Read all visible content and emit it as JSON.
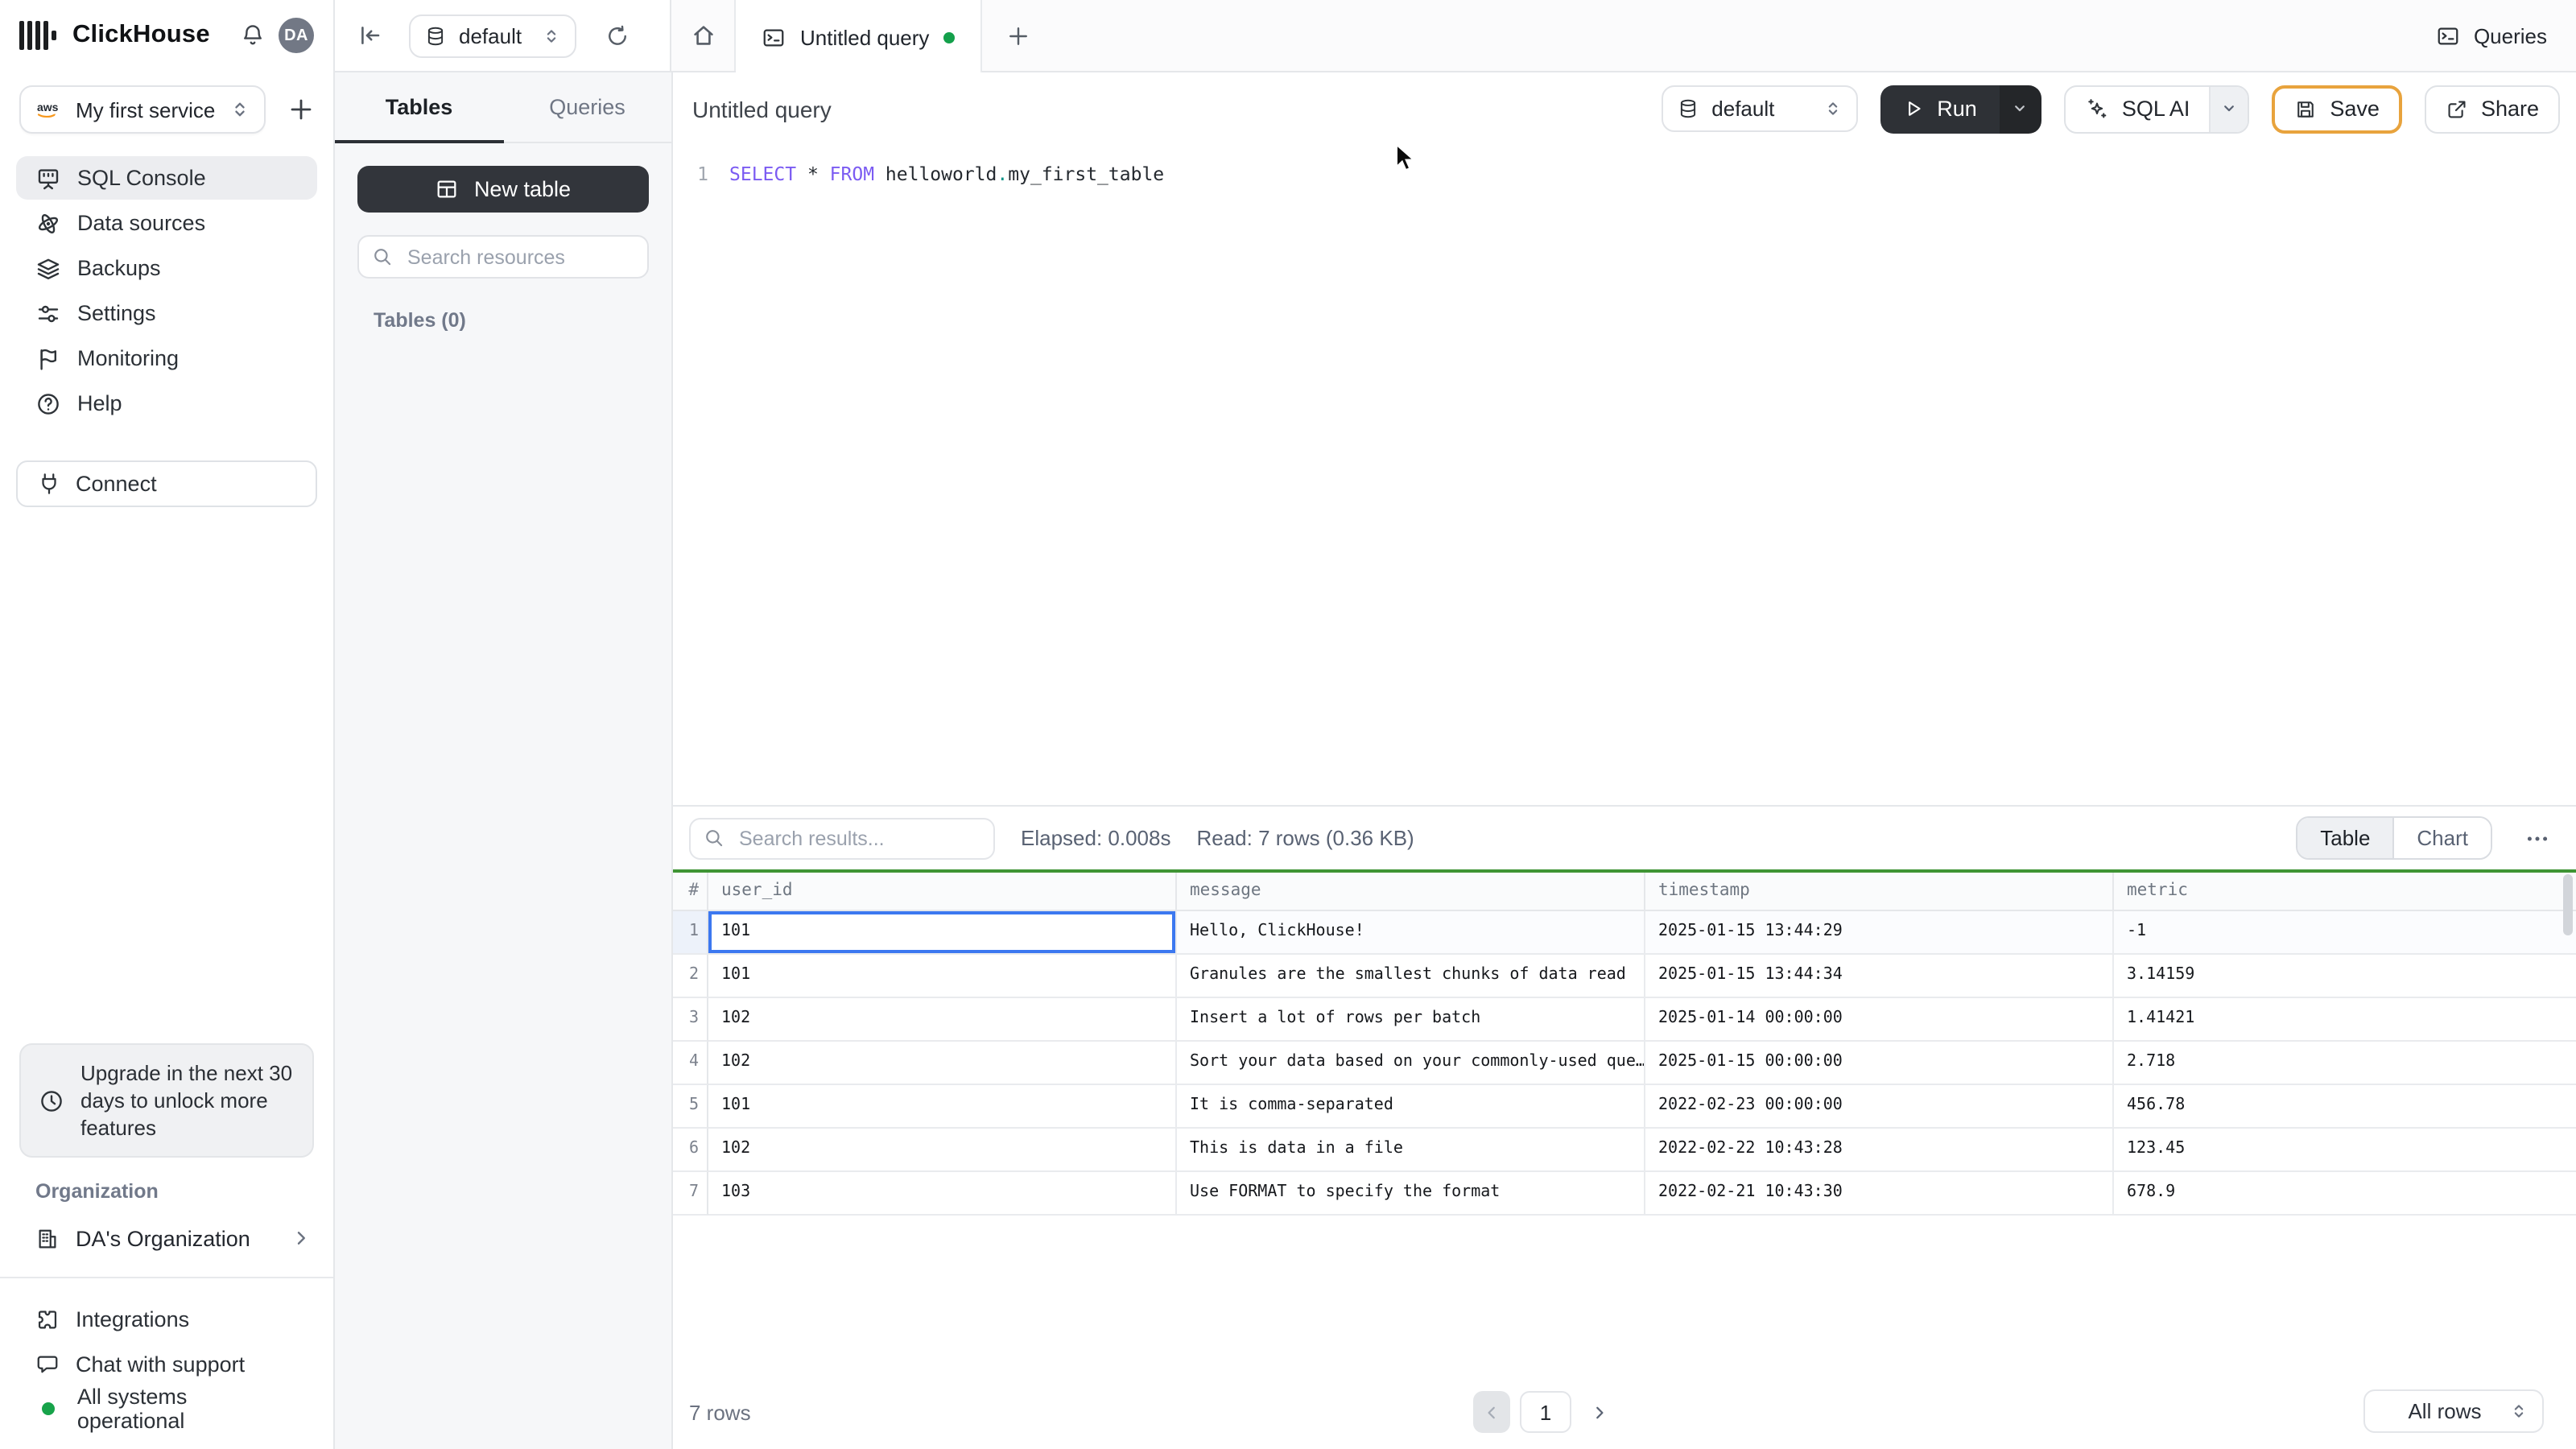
{
  "app": {
    "brand": "ClickHouse",
    "avatar": "DA"
  },
  "sidebar": {
    "service": {
      "label": "My first service",
      "provider": "aws"
    },
    "nav": [
      {
        "label": "SQL Console"
      },
      {
        "label": "Data sources"
      },
      {
        "label": "Backups"
      },
      {
        "label": "Settings"
      },
      {
        "label": "Monitoring"
      },
      {
        "label": "Help"
      }
    ],
    "connect": "Connect",
    "upgrade_notice": "Upgrade in the next 30 days to unlock more features",
    "org_section": "Organization",
    "org_name": "DA's Organization",
    "footer": [
      {
        "label": "Integrations"
      },
      {
        "label": "Chat with support"
      },
      {
        "label": "All systems operational"
      }
    ]
  },
  "topbar": {
    "database": "default",
    "tab": "Untitled query",
    "queries": "Queries"
  },
  "panel": {
    "tab_tables": "Tables",
    "tab_queries": "Queries",
    "new_table": "New table",
    "search_placeholder": "Search resources",
    "section": "Tables (0)"
  },
  "editor": {
    "title": "Untitled query",
    "database": "default",
    "run": "Run",
    "sql_ai": "SQL AI",
    "save": "Save",
    "share": "Share",
    "line_no": "1",
    "sql_select": "SELECT",
    "sql_star": " * ",
    "sql_from": "FROM",
    "sql_schema": " helloworld",
    "sql_dot": ".",
    "sql_table": "my_first_table"
  },
  "results": {
    "search_placeholder": "Search results...",
    "elapsed": "Elapsed: 0.008s",
    "read": "Read: 7 rows (0.36 KB)",
    "toggle_table": "Table",
    "toggle_chart": "Chart",
    "columns": [
      "#",
      "user_id",
      "message",
      "timestamp",
      "metric"
    ],
    "rows": [
      [
        "1",
        "101",
        "Hello, ClickHouse!",
        "2025-01-15 13:44:29",
        "-1"
      ],
      [
        "2",
        "101",
        "Granules are the smallest chunks of data read",
        "2025-01-15 13:44:34",
        "3.14159"
      ],
      [
        "3",
        "102",
        "Insert a lot of rows per batch",
        "2025-01-14 00:00:00",
        "1.41421"
      ],
      [
        "4",
        "102",
        "Sort your data based on your commonly-used que…",
        "2025-01-15 00:00:00",
        "2.718"
      ],
      [
        "5",
        "101",
        "It is comma-separated",
        "2022-02-23 00:00:00",
        "456.78"
      ],
      [
        "6",
        "102",
        "This is data in a file",
        "2022-02-22 10:43:28",
        "123.45"
      ],
      [
        "7",
        "103",
        "Use FORMAT to specify the format",
        "2022-02-21 10:43:30",
        "678.9"
      ]
    ],
    "footer": {
      "count": "7 rows",
      "page": "1",
      "page_size": "All rows"
    }
  },
  "colors": {
    "table_accent_green": "#3f9434",
    "tab_dot_green": "#14a04b",
    "status_green": "#17a34a",
    "selected_cell_blue": "#3c78f0",
    "save_border_gold": "#e8a33d",
    "keyword_purple": "#7b5bf2"
  }
}
